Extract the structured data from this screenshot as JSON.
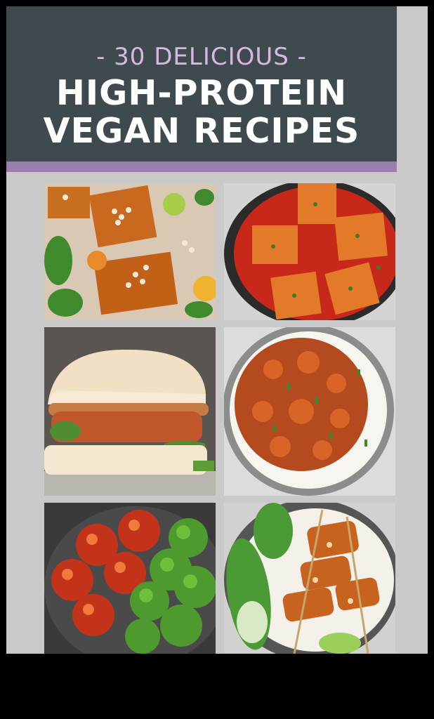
{
  "header": {
    "subtitle": "- 30 DELICIOUS -",
    "title_line1": "HIGH-PROTEIN",
    "title_line2": "VEGAN RECIPES"
  },
  "colors": {
    "header_bg": "#3e4a4e",
    "accent_strip": "#9b7fb0",
    "subtitle_text": "#d7b8e3",
    "title_text": "#ffffff"
  },
  "photos": [
    {
      "name": "baked-tofu-white-beans-photo"
    },
    {
      "name": "tofu-tomato-sauce-skillet-photo"
    },
    {
      "name": "crispy-tofu-sandwich-photo"
    },
    {
      "name": "bbq-tempeh-rice-bowl-photo"
    },
    {
      "name": "meatballs-broccoli-plate-photo"
    },
    {
      "name": "tofu-satay-skewers-bok-choy-photo"
    }
  ]
}
